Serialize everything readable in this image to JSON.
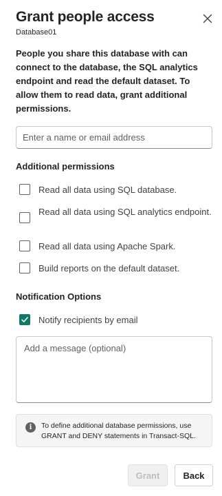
{
  "header": {
    "title": "Grant people access",
    "subtitle": "Database01",
    "close_icon": "close-icon"
  },
  "description": "People you share this database with can connect to the database, the SQL analytics endpoint and read the default dataset. To allow them to read data, grant additional permissions.",
  "name_input": {
    "value": "",
    "placeholder": "Enter a name or email address"
  },
  "permissions": {
    "title": "Additional permissions",
    "items": [
      {
        "label": "Read all data using SQL database.",
        "checked": false
      },
      {
        "label": "Read all data using SQL analytics endpoint.",
        "checked": false
      },
      {
        "label": "Read all data using Apache Spark.",
        "checked": false
      },
      {
        "label": "Build reports on the default dataset.",
        "checked": false
      }
    ]
  },
  "notifications": {
    "title": "Notification Options",
    "notify_label": "Notify recipients by email",
    "notify_checked": true,
    "message_placeholder": "Add a message (optional)",
    "message_value": ""
  },
  "info": {
    "icon": "info-icon",
    "text": "To define additional database permissions, use GRANT and DENY statements in Transact-SQL."
  },
  "buttons": {
    "grant": "Grant",
    "grant_enabled": false,
    "back": "Back"
  },
  "colors": {
    "accent": "#117865",
    "text": "#242424",
    "muted": "#616161"
  }
}
